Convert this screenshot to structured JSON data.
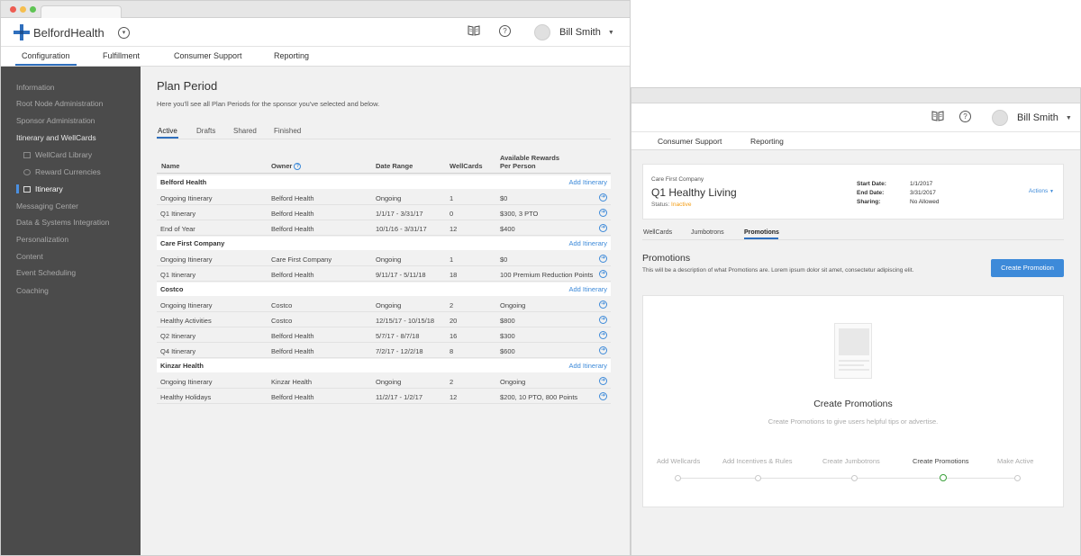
{
  "left": {
    "brand": "BelfordHealth",
    "user_name": "Bill Smith",
    "subnav": [
      "Configuration",
      "Fulfillment",
      "Consumer Support",
      "Reporting"
    ],
    "sidebar": [
      "Information",
      "Root Node Administration",
      "Sponsor Administration",
      "Itinerary and WellCards",
      "WellCard Library",
      "Reward Currencies",
      "Itinerary",
      "Messaging Center",
      "Data & Systems Integration",
      "Personalization",
      "Content",
      "Event Scheduling",
      "Coaching"
    ],
    "page_title": "Plan Period",
    "page_subtitle": "Here you'll see all Plan Periods for the sponsor you've selected and below.",
    "tabs": [
      "Active",
      "Drafts",
      "Shared",
      "Finished"
    ],
    "columns": {
      "name": "Name",
      "owner": "Owner",
      "date_range": "Date Range",
      "wellcards": "WellCards",
      "rewards_line1": "Available Rewards",
      "rewards_line2": "Per Person"
    },
    "add_itinerary": "Add Itinerary",
    "groups": [
      {
        "name": "Belford Health",
        "rows": [
          {
            "name": "Ongoing Itinerary",
            "owner": "Belford Health",
            "date": "Ongoing",
            "wellcards": "1",
            "rewards": "$0"
          },
          {
            "name": "Q1 Itinerary",
            "owner": "Belford Health",
            "date": "1/1/17 - 3/31/17",
            "wellcards": "0",
            "rewards": "$300, 3 PTO"
          },
          {
            "name": "End of Year",
            "owner": "Belford Health",
            "date": "10/1/16 - 3/31/17",
            "wellcards": "12",
            "rewards": "$400"
          }
        ]
      },
      {
        "name": "Care First Company",
        "rows": [
          {
            "name": "Ongoing Itinerary",
            "owner": "Care First Company",
            "date": "Ongoing",
            "wellcards": "1",
            "rewards": "$0"
          },
          {
            "name": "Q1 Itinerary",
            "owner": "Belford Health",
            "date": "9/11/17 - 5/11/18",
            "wellcards": "18",
            "rewards": "100 Premium Reduction Points"
          }
        ]
      },
      {
        "name": "Costco",
        "rows": [
          {
            "name": "Ongoing Itinerary",
            "owner": "Costco",
            "date": "Ongoing",
            "wellcards": "2",
            "rewards": "Ongoing"
          },
          {
            "name": "Healthy Activities",
            "owner": "Costco",
            "date": "12/15/17 - 10/15/18",
            "wellcards": "20",
            "rewards": "$800"
          },
          {
            "name": "Q2 Itinerary",
            "owner": "Belford Health",
            "date": "5/7/17 - 8/7/18",
            "wellcards": "16",
            "rewards": "$300"
          },
          {
            "name": "Q4 Itinerary",
            "owner": "Belford Health",
            "date": "7/2/17 - 12/2/18",
            "wellcards": "8",
            "rewards": "$600"
          }
        ]
      },
      {
        "name": "Kinzar Health",
        "rows": [
          {
            "name": "Ongoing Itinerary",
            "owner": "Kinzar Health",
            "date": "Ongoing",
            "wellcards": "2",
            "rewards": "Ongoing"
          },
          {
            "name": "Healthy Holidays",
            "owner": "Belford Health",
            "date": "11/2/17 - 1/2/17",
            "wellcards": "12",
            "rewards": "$200, 10 PTO, 800 Points"
          }
        ]
      }
    ]
  },
  "right": {
    "user_name": "Bill Smith",
    "subnav": [
      "Consumer Support",
      "Reporting"
    ],
    "card": {
      "sponsor": "Care First Company",
      "plan_name": "Q1 Healthy Living",
      "status_label": "Status:",
      "status_value": "Inactive",
      "start_label": "Start Date:",
      "start_value": "1/1/2017",
      "end_label": "End Date:",
      "end_value": "3/31/2017",
      "sharing_label": "Sharing:",
      "sharing_value": "No Allowed",
      "actions": "Actions"
    },
    "tabs": [
      "WellCards",
      "Jumbotrons",
      "Promotions"
    ],
    "section_title": "Promotions",
    "section_desc": "This will be a description of what Promotions are. Lorem ipsum dolor sit amet, consectetur adipiscing elit.",
    "create_button": "Create Promotion",
    "empty_title": "Create Promotions",
    "empty_sub": "Create Promotions to give users helpful tips or advertise.",
    "steps": [
      "Add Wellcards",
      "Add Incentives & Rules",
      "Create Jumbotrons",
      "Create Promotions",
      "Make Active"
    ],
    "current_step": 3
  },
  "colors": {
    "accent": "#3d8ad9",
    "sidebar_bg": "#4b4b4b",
    "status_inactive": "#f39c12",
    "step_current": "#3aa03a"
  }
}
